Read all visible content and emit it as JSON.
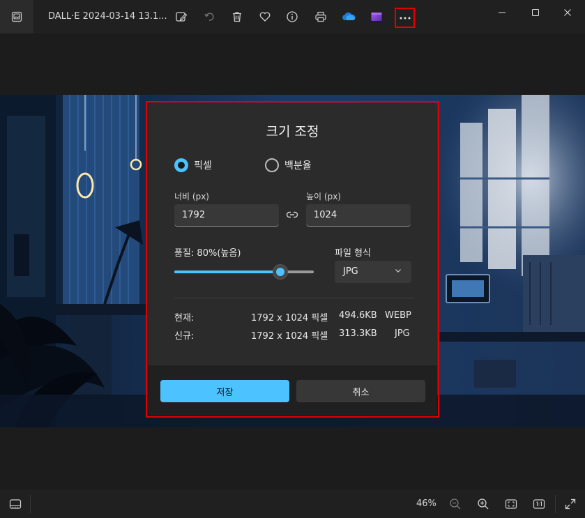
{
  "window": {
    "title": "DALL·E 2024-03-14 13.1...",
    "icons": [
      "gallery-icon",
      "edit-image-icon",
      "rotate-icon",
      "delete-icon",
      "favorite-icon",
      "info-icon",
      "print-icon",
      "onedrive-icon",
      "clipchamp-icon",
      "more-options-icon",
      "minimize-icon",
      "maximize-icon",
      "close-icon"
    ]
  },
  "dialog": {
    "title": "크기 조정",
    "mode_options": [
      {
        "label": "픽셀",
        "selected": true
      },
      {
        "label": "백분율",
        "selected": false
      }
    ],
    "width_label": "너비 (px)",
    "width_value": "1792",
    "height_label": "높이 (px)",
    "height_value": "1024",
    "quality_label": "품질: 80%(높음)",
    "quality_percent": 80,
    "format_label": "파일 형식",
    "format_value": "JPG",
    "current_label": "현재:",
    "current_dims": "1792 x 1024 픽셀",
    "current_size": "494.6KB",
    "current_format": "WEBP",
    "new_label": "신규:",
    "new_dims": "1792 x 1024 픽셀",
    "new_size": "313.3KB",
    "new_format": "JPG",
    "save_label": "저장",
    "cancel_label": "취소"
  },
  "bottombar": {
    "zoom": "46%"
  },
  "colors": {
    "accent": "#4cc2ff",
    "highlight": "#e00000",
    "dialog_bg": "#2b2b2b"
  }
}
